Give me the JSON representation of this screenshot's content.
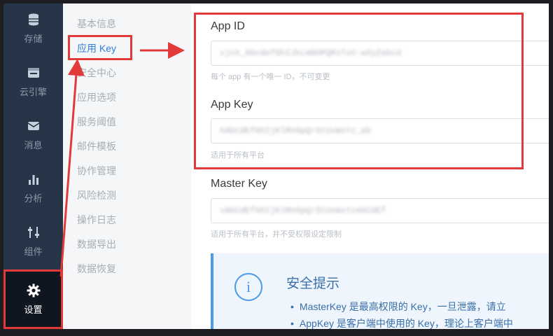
{
  "sidebar": {
    "items": [
      {
        "label": "存储",
        "icon": "database-icon"
      },
      {
        "label": "云引擎",
        "icon": "cloud-engine-icon"
      },
      {
        "label": "消息",
        "icon": "message-icon"
      },
      {
        "label": "分析",
        "icon": "bar-chart-icon"
      },
      {
        "label": "组件",
        "icon": "sliders-icon"
      },
      {
        "label": "设置",
        "icon": "gear-icon",
        "active": true
      }
    ]
  },
  "submenu": {
    "items": [
      {
        "label": "基本信息"
      },
      {
        "label": "应用 Key",
        "active": true
      },
      {
        "label": "安全中心"
      },
      {
        "label": "应用选项"
      },
      {
        "label": "服务阈值"
      },
      {
        "label": "邮件模板"
      },
      {
        "label": "协作管理"
      },
      {
        "label": "风险检测"
      },
      {
        "label": "操作日志"
      },
      {
        "label": "数据导出"
      },
      {
        "label": "数据恢复"
      }
    ]
  },
  "fields": {
    "app_id": {
      "title": "App ID",
      "value": "xjnX_AbcdefGhIJkLmNOPQRsTuV-wXyZabcd",
      "hint": "每个 app 有一个唯一 ID，不可变更"
    },
    "app_key": {
      "title": "App Key",
      "value": "hAbCdEfGhIjKlMnOpQrStUvWxYz_ab",
      "hint": "适用于所有平台"
    },
    "master_key": {
      "title": "Master Key",
      "value": "vAbCdEfGhIjKlMnOpQrStUvWxYzAbCdEf",
      "hint": "适用于所有平台，并不受权限设定限制"
    }
  },
  "notice": {
    "title": "安全提示",
    "lines": [
      "MasterKey 是最高权限的 Key，一旦泄露，请立",
      "AppKey 是客户端中使用的 Key，理论上客户端中"
    ]
  },
  "colors": {
    "highlight": "#e23a3a",
    "sidebar_bg": "#263547",
    "link": "#2f7fdc",
    "notice_accent": "#4a9ae6"
  }
}
